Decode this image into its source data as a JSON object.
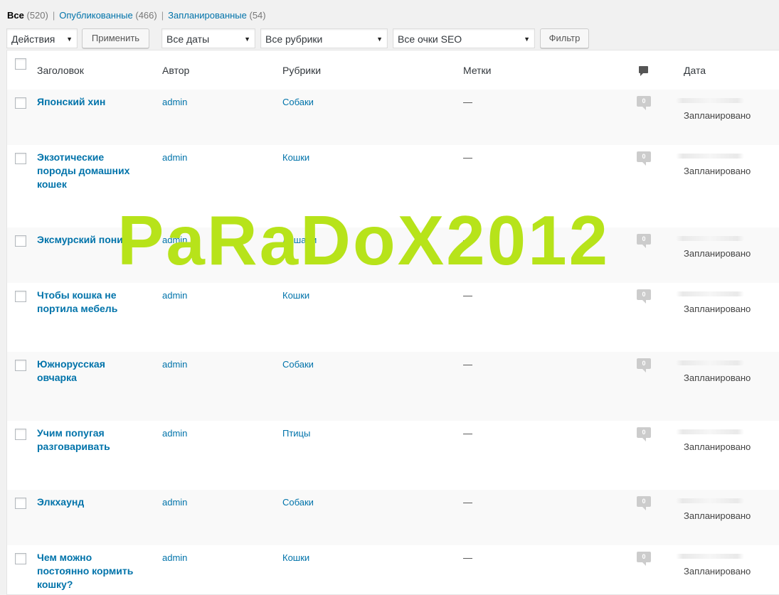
{
  "subsubsub": {
    "all_label": "Все",
    "all_count": "(520)",
    "published_label": "Опубликованные",
    "published_count": "(466)",
    "scheduled_label": "Запланированные",
    "scheduled_count": "(54)",
    "separator": "|"
  },
  "toolbar": {
    "bulk_actions": "Действия",
    "apply_label": "Применить",
    "dates_filter": "Все даты",
    "categories_filter": "Все рубрики",
    "seo_filter": "Все очки SEO",
    "filter_label": "Фильтр",
    "dropdown_arrow": "▼"
  },
  "columns": {
    "title": "Заголовок",
    "author": "Автор",
    "categories": "Рубрики",
    "tags": "Метки",
    "comments_icon": "comment-icon",
    "date": "Дата"
  },
  "rows": [
    {
      "title": "Японский хин",
      "author": "admin",
      "category": "Собаки",
      "tags": "—",
      "comments": "0",
      "status": "Запланировано"
    },
    {
      "title": "Экзотические породы домашних кошек",
      "author": "admin",
      "category": "Кошки",
      "tags": "—",
      "comments": "0",
      "status": "Запланировано"
    },
    {
      "title": "Эксмурский пони",
      "author": "admin",
      "category": "Лошади",
      "tags": "—",
      "comments": "0",
      "status": "Запланировано"
    },
    {
      "title": "Чтобы кошка не портила мебель",
      "author": "admin",
      "category": "Кошки",
      "tags": "—",
      "comments": "0",
      "status": "Запланировано"
    },
    {
      "title": "Южнорусская овчарка",
      "author": "admin",
      "category": "Собаки",
      "tags": "—",
      "comments": "0",
      "status": "Запланировано"
    },
    {
      "title": "Учим попугая разговаривать",
      "author": "admin",
      "category": "Птицы",
      "tags": "—",
      "comments": "0",
      "status": "Запланировано"
    },
    {
      "title": "Элкхаунд",
      "author": "admin",
      "category": "Собаки",
      "tags": "—",
      "comments": "0",
      "status": "Запланировано"
    },
    {
      "title": "Чем можно постоянно кормить кошку?",
      "author": "admin",
      "category": "Кошки",
      "tags": "—",
      "comments": "0",
      "status": "Запланировано"
    }
  ],
  "watermark": "PaRaDoX2012",
  "colors": {
    "link": "#0073aa",
    "watermark": "#b7e31a",
    "bubble": "#cccccc"
  }
}
